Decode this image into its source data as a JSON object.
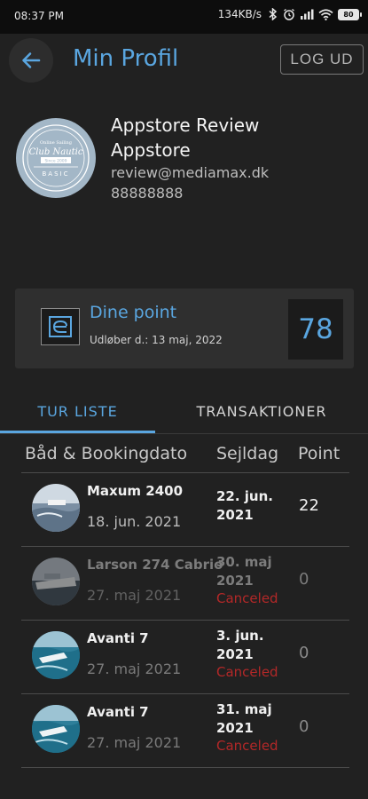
{
  "status_bar": {
    "time": "08:37 PM",
    "net_speed": "134KB/s",
    "battery": "80"
  },
  "header": {
    "title": "Min Profil",
    "logout_label": "LOG UD"
  },
  "profile": {
    "avatar_lines": [
      "Online Sailing",
      "Club Nautic",
      "Since 2009",
      "BASIC"
    ],
    "name": "Appstore Review Appstore",
    "email": "review@mediamax.dk",
    "phone": "88888888"
  },
  "points": {
    "title": "Dine point",
    "expiry": "Udløber d.: 13 maj, 2022",
    "value": "78"
  },
  "tabs": [
    {
      "label": "TUR LISTE"
    },
    {
      "label": "TRANSAKTIONER"
    }
  ],
  "table": {
    "headers": {
      "boat": "Båd & Bookingdato",
      "day": "Sejldag",
      "points": "Point"
    },
    "rows": [
      {
        "boat": "Maxum 2400",
        "booking_date": "18. jun. 2021",
        "sail_day": "22. jun. 2021",
        "status": "",
        "points": "22"
      },
      {
        "boat": "Larson 274 Cabrio",
        "booking_date": "27. maj 2021",
        "sail_day": "30. maj 2021",
        "status": "Canceled",
        "points": "0"
      },
      {
        "boat": "Avanti 7",
        "booking_date": "27. maj 2021",
        "sail_day": "3. jun. 2021",
        "status": "Canceled",
        "points": "0"
      },
      {
        "boat": "Avanti 7",
        "booking_date": "27. maj 2021",
        "sail_day": "31. maj 2021",
        "status": "Canceled",
        "points": "0"
      }
    ]
  },
  "colors": {
    "accent": "#5aa6e0",
    "background": "#212121",
    "card": "#2f2f2f",
    "canceled": "#b32828"
  },
  "icons": [
    "back-arrow-icon",
    "wifi-icon",
    "signal-icon",
    "alarm-icon",
    "bluetooth-icon",
    "points-logo-icon"
  ]
}
